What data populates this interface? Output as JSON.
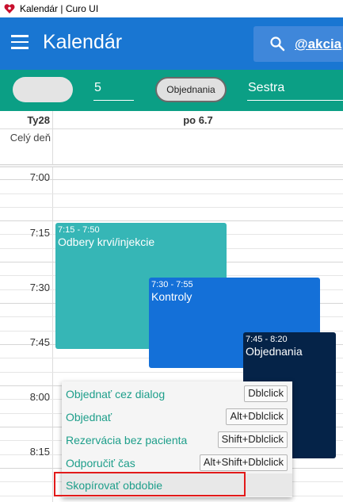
{
  "window": {
    "title": "Kalendár | Curo UI"
  },
  "appbar": {
    "title": "Kalendár",
    "search_value": "@akcia"
  },
  "filters": {
    "count_value": "5",
    "chip_label": "Objednania",
    "role_value": "Sestra"
  },
  "calendar": {
    "week_label": "Ty28",
    "day_label": "po 6.7",
    "allday_label": "Celý deň",
    "time_labels": [
      "7:00",
      "7:15",
      "7:30",
      "7:45",
      "8:00",
      "8:15"
    ],
    "events": [
      {
        "time": "7:15 - 7:50",
        "title": "Odbery krvi/injekcie",
        "color": "#36b6b6"
      },
      {
        "time": "7:30 - 7:55",
        "title": "Kontroly",
        "color": "#1470d8"
      },
      {
        "time": "7:45 - 8:20",
        "title": "Objednania",
        "color": "#052348"
      }
    ]
  },
  "context_menu": {
    "items": [
      {
        "label": "Objednať cez dialog",
        "shortcut": "Dblclick"
      },
      {
        "label": "Objednať",
        "shortcut": "Alt+Dblclick"
      },
      {
        "label": "Rezervácia bez pacienta",
        "shortcut": "Shift+Dblclick"
      },
      {
        "label": "Odporučiť čas",
        "shortcut": "Alt+Shift+Dblclick"
      },
      {
        "label": "Skopírovať obdobie",
        "shortcut": ""
      }
    ]
  },
  "colors": {
    "appbar": "#1976d2",
    "filterbar": "#0b9f85",
    "menu_text": "#1d9e8a",
    "highlight": "#e21a1a"
  },
  "icons": {
    "app": "heart-logo-icon",
    "menu": "hamburger-menu-icon",
    "search": "search-icon"
  }
}
